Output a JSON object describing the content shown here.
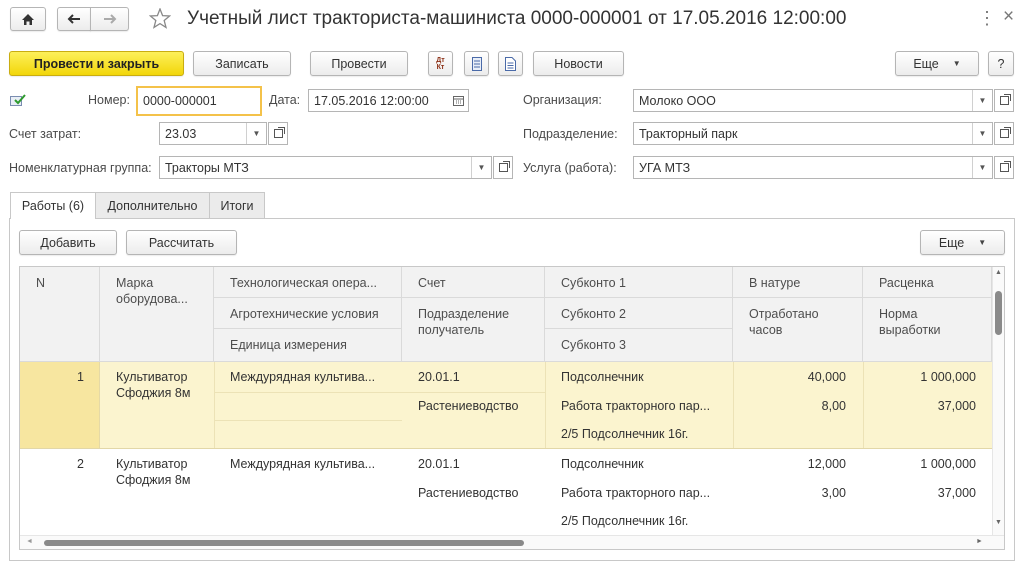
{
  "window": {
    "title": "Учетный лист тракториста-машиниста 0000-000001 от 17.05.2016 12:00:00",
    "close_glyph": "×",
    "more_glyph": "⋮"
  },
  "toolbar": {
    "post_close": "Провести и закрыть",
    "save": "Записать",
    "post": "Провести",
    "dt_kt": "Дт\nКт",
    "news": "Новости",
    "more": "Еще",
    "help": "?"
  },
  "form": {
    "number_label": "Номер:",
    "number_value": "0000-000001",
    "date_label": "Дата:",
    "date_value": "17.05.2016 12:00:00",
    "org_label": "Организация:",
    "org_value": "Молоко ООО",
    "cost_account_label": "Счет затрат:",
    "cost_account_value": "23.03",
    "dept_label": "Подразделение:",
    "dept_value": "Тракторный парк",
    "nomgroup_label": "Номенклатурная группа:",
    "nomgroup_value": "Тракторы МТЗ",
    "service_label": "Услуга (работа):",
    "service_value": "УГА МТЗ"
  },
  "tabs": [
    "Работы (6)",
    "Дополнительно",
    "Итоги"
  ],
  "table_toolbar": {
    "add": "Добавить",
    "calc": "Рассчитать",
    "more": "Еще"
  },
  "columns": {
    "n": "N",
    "brand": "Марка оборудова...",
    "tech_op": "Технологическая опера...",
    "agro": "Агротехнические условия",
    "unit": "Единица измерения",
    "account": "Счет",
    "dept_recv": "Подразделение получатель",
    "sub1": "Субконто 1",
    "sub2": "Субконто 2",
    "sub3": "Субконто 3",
    "natural": "В натуре",
    "hours": "Отработано часов",
    "rate": "Расценка",
    "norm": "Норма выработки"
  },
  "rows": [
    {
      "n": "1",
      "brand": "Культиватор Сфоджия 8м",
      "tech_op": "Междурядная культива...",
      "account": "20.01.1",
      "dept_recv": "Растениеводство",
      "sub1": "Подсолнечник",
      "sub2": "Работа тракторного пар...",
      "sub3": "2/5 Подсолнечник 16г.",
      "natural": "40,000",
      "hours": "8,00",
      "rate": "1 000,000",
      "norm": "37,000"
    },
    {
      "n": "2",
      "brand": "Культиватор Сфоджия 8м",
      "tech_op": "Междурядная культива...",
      "account": "20.01.1",
      "dept_recv": "Растениеводство",
      "sub1": "Подсолнечник",
      "sub2": "Работа тракторного пар...",
      "sub3": "2/5 Подсолнечник 16г.",
      "natural": "12,000",
      "hours": "3,00",
      "rate": "1 000,000",
      "norm": "37,000"
    }
  ],
  "colors": {
    "primary_button": "#f4d81f",
    "selected_row": "#fbf4cf",
    "selected_cell": "#f7e6a0",
    "focus_border": "#f4c24a"
  }
}
